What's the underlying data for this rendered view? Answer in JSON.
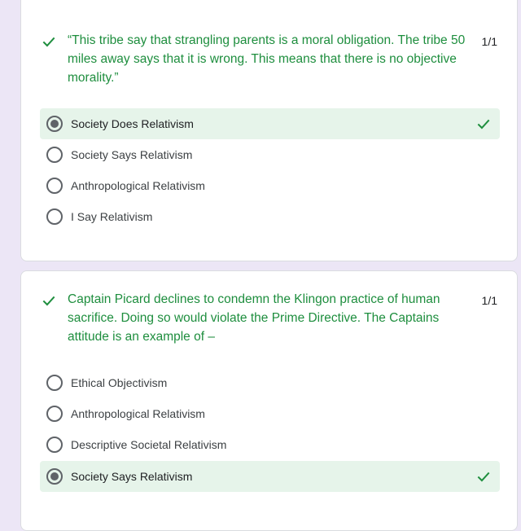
{
  "questions": [
    {
      "text": "“This tribe say that strangling parents is a moral obligation. The tribe 50 miles away says that it is wrong. This means that there is no objective morality.”",
      "score": "1/1",
      "options": [
        {
          "label": "Society Does Relativism",
          "selected": true,
          "correct": true
        },
        {
          "label": "Society Says Relativism",
          "selected": false
        },
        {
          "label": "Anthropological Relativism",
          "selected": false
        },
        {
          "label": "I Say Relativism",
          "selected": false
        }
      ]
    },
    {
      "text": "Captain Picard declines to condemn the Klingon practice of human sacrifice. Doing so would violate the Prime Directive. The Captains attitude is an example of –",
      "score": "1/1",
      "options": [
        {
          "label": "Ethical Objectivism",
          "selected": false
        },
        {
          "label": "Anthropological Relativism",
          "selected": false
        },
        {
          "label": "Descriptive Societal Relativism",
          "selected": false
        },
        {
          "label": "Society Says Relativism",
          "selected": true,
          "correct": true
        }
      ]
    }
  ],
  "colors": {
    "correct_green": "#1e8e3e",
    "selected_bg": "#e6f4ea",
    "page_bg": "#ece6f6"
  },
  "icons": {
    "question_status": "checkmark-icon",
    "correct_answer": "checkmark-icon"
  }
}
